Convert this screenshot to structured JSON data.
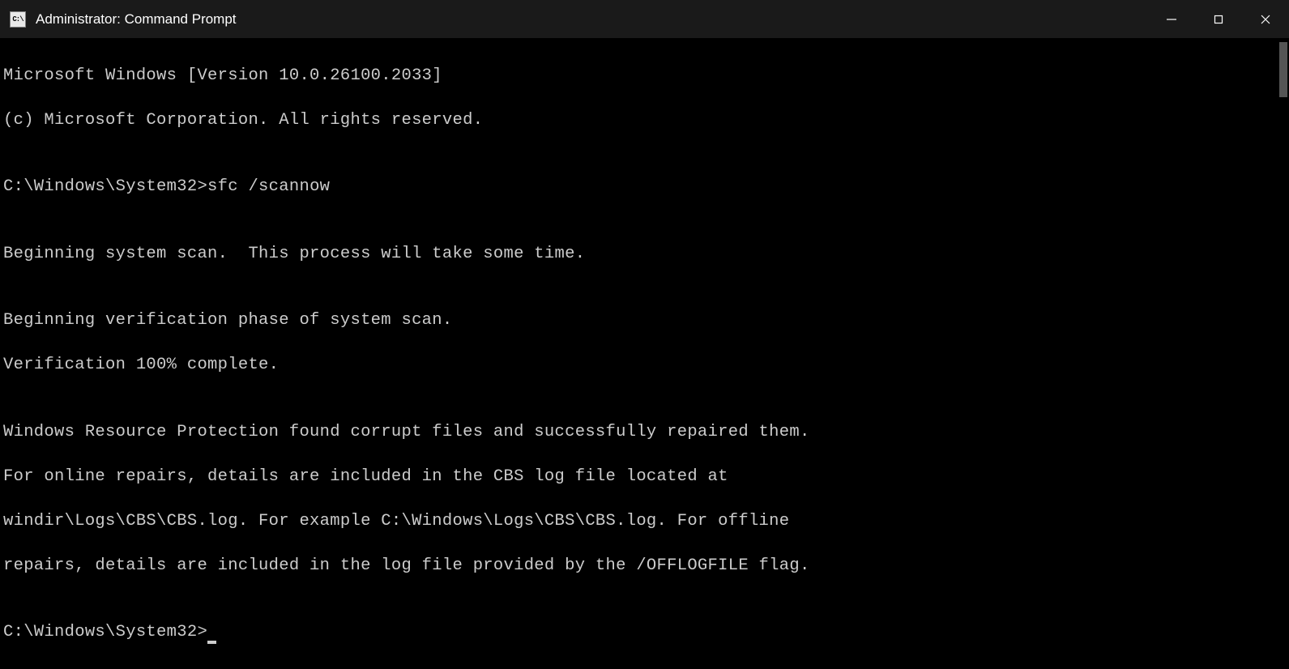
{
  "titlebar": {
    "icon_text": "C:\\",
    "title": "Administrator: Command Prompt"
  },
  "terminal": {
    "lines": {
      "version": "Microsoft Windows [Version 10.0.26100.2033]",
      "copyright": "(c) Microsoft Corporation. All rights reserved.",
      "blank1": "",
      "prompt1_path": "C:\\Windows\\System32>",
      "prompt1_cmd": "sfc /scannow",
      "blank2": "",
      "scan_begin": "Beginning system scan.  This process will take some time.",
      "blank3": "",
      "verify_begin": "Beginning verification phase of system scan.",
      "verify_complete": "Verification 100% complete.",
      "blank4": "",
      "result1": "Windows Resource Protection found corrupt files and successfully repaired them.",
      "result2": "For online repairs, details are included in the CBS log file located at",
      "result3": "windir\\Logs\\CBS\\CBS.log. For example C:\\Windows\\Logs\\CBS\\CBS.log. For offline",
      "result4": "repairs, details are included in the log file provided by the /OFFLOGFILE flag.",
      "blank5": "",
      "prompt2_path": "C:\\Windows\\System32>"
    }
  }
}
